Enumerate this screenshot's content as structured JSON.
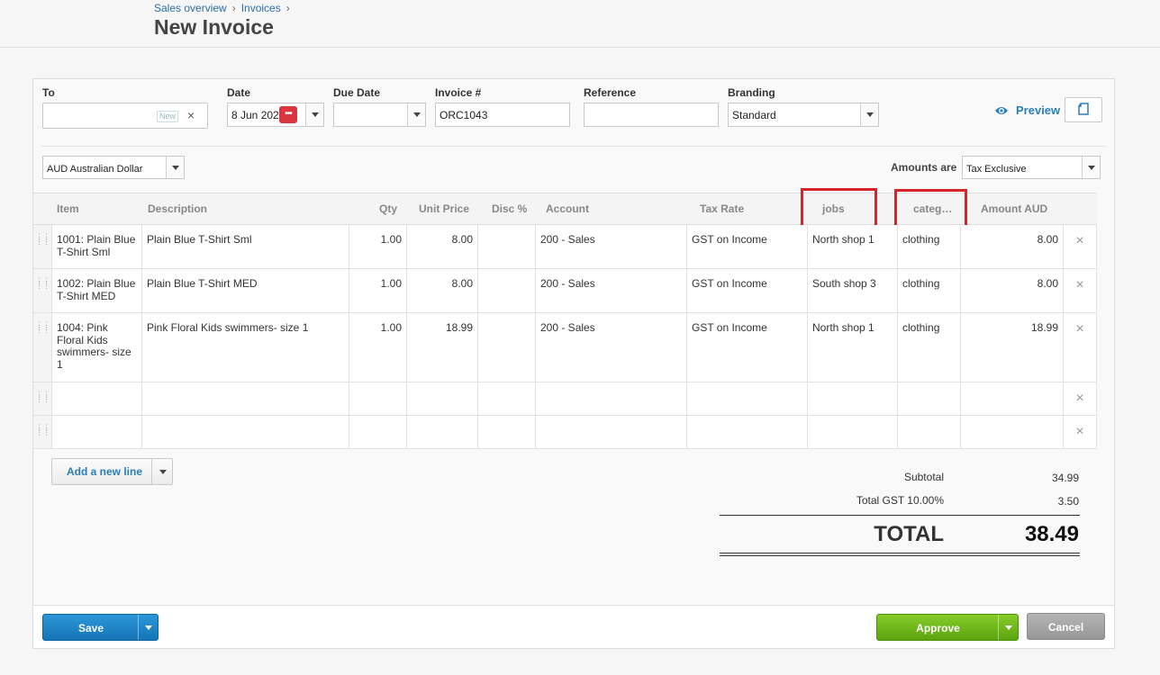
{
  "breadcrumb": [
    "Sales overview",
    "Invoices"
  ],
  "page_title": "New Invoice",
  "form": {
    "to": {
      "label": "To",
      "value": "",
      "badge": "New"
    },
    "date": {
      "label": "Date",
      "value": "8 Jun 202"
    },
    "due_date": {
      "label": "Due Date",
      "value": ""
    },
    "invoice_number": {
      "label": "Invoice #",
      "value": "ORC1043"
    },
    "reference": {
      "label": "Reference",
      "value": ""
    },
    "branding": {
      "label": "Branding",
      "value": "Standard"
    },
    "preview_label": "Preview"
  },
  "currency": "AUD Australian Dollar",
  "amounts_are": {
    "label": "Amounts are",
    "value": "Tax Exclusive"
  },
  "table": {
    "columns": {
      "item": "Item",
      "description": "Description",
      "qty": "Qty",
      "unit_price": "Unit Price",
      "disc": "Disc %",
      "account": "Account",
      "tax_rate": "Tax Rate",
      "jobs": "jobs",
      "category": "categ…",
      "amount": "Amount AUD"
    },
    "rows": [
      {
        "item": "1001: Plain Blue T-Shirt Sml",
        "description": "Plain Blue T-Shirt Sml",
        "qty": "1.00",
        "unit_price": "8.00",
        "disc": "",
        "account": "200 - Sales",
        "tax_rate": "GST on Income",
        "jobs": "North shop 1",
        "category": "clothing",
        "amount": "8.00"
      },
      {
        "item": "1002: Plain Blue T-Shirt MED",
        "description": "Plain Blue T-Shirt MED",
        "qty": "1.00",
        "unit_price": "8.00",
        "disc": "",
        "account": "200 - Sales",
        "tax_rate": "GST on Income",
        "jobs": "South shop 3",
        "category": "clothing",
        "amount": "8.00"
      },
      {
        "item": "1004: Pink Floral Kids swimmers- size 1",
        "description": "Pink Floral Kids swimmers- size 1",
        "qty": "1.00",
        "unit_price": "18.99",
        "disc": "",
        "account": "200 - Sales",
        "tax_rate": "GST on Income",
        "jobs": "North shop 1",
        "category": "clothing",
        "amount": "18.99"
      },
      {
        "item": "",
        "description": "",
        "qty": "",
        "unit_price": "",
        "disc": "",
        "account": "",
        "tax_rate": "",
        "jobs": "",
        "category": "",
        "amount": ""
      },
      {
        "item": "",
        "description": "",
        "qty": "",
        "unit_price": "",
        "disc": "",
        "account": "",
        "tax_rate": "",
        "jobs": "",
        "category": "",
        "amount": ""
      }
    ]
  },
  "add_line_label": "Add a new line",
  "totals": {
    "subtotal_label": "Subtotal",
    "subtotal": "34.99",
    "gst_label": "Total GST 10.00%",
    "gst": "3.50",
    "total_label": "TOTAL",
    "total": "38.49"
  },
  "buttons": {
    "save": "Save",
    "approve": "Approve",
    "cancel": "Cancel"
  },
  "colors": {
    "accent": "#2a7fb8",
    "save": "#1d86c8",
    "approve": "#6db71c",
    "highlight": "#d8232a"
  }
}
